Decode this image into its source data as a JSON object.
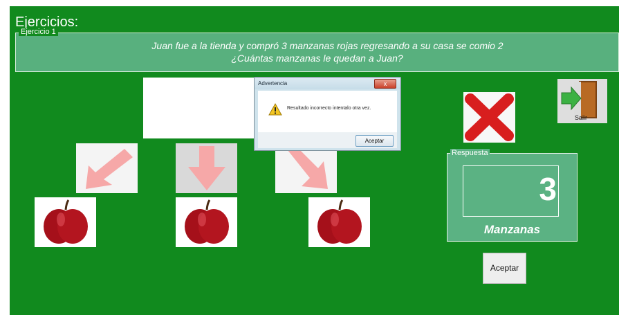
{
  "window": {
    "title": "Ejercicios:"
  },
  "exercise": {
    "legend": "Ejercicio 1",
    "question_line1": "Juan fue a la tienda y compró 3 manzanas rojas regresando a su casa  se comio 2",
    "question_line2": "¿Cuántas manzanas le quedan a Juan?"
  },
  "dialog": {
    "title": "Advertencia",
    "close_symbol": "x",
    "message": "Resultado incorrecto intentalo otra vez.",
    "ok_label": "Aceptar",
    "icon": "warning-icon"
  },
  "exit": {
    "label": "Salir",
    "icon": "exit-door-icon"
  },
  "answer": {
    "legend": "Respuesta",
    "value": "3",
    "unit": "Manzanas"
  },
  "accept_button": {
    "label": "Aceptar"
  },
  "colors": {
    "background": "#118a1e",
    "panel": "#58b07e",
    "error": "#d81e1e",
    "arrow": "#f6a8a8"
  }
}
